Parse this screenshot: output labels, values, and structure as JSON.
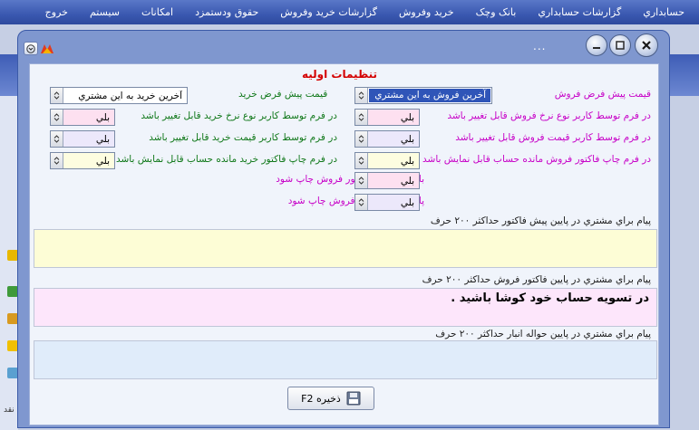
{
  "menu": {
    "items": [
      "حسابداري",
      "گزارشات حسابداري",
      "بانک وچک",
      "خريد وفروش",
      "گزارشات خريد وفروش",
      "حقوق ودستمزد",
      "امکانات",
      "سيستم",
      "خروج"
    ]
  },
  "desktop": {
    "side_text": "نقد"
  },
  "window": {
    "title_dots": "...",
    "heading": "تنظيمات اوليه"
  },
  "form": {
    "sales_default_label": "قيمت پيش فرض فروش",
    "sales_default_value": "آخرين فروش به اين مشتري",
    "purchase_default_label": "قيمت پيش فرض خريد",
    "purchase_default_value": "آخرين خريد به اين مشتري",
    "sales_rows": [
      {
        "label": "در فرم توسط کاربر نوع نرخ  فروش  قابل تغيير باشد",
        "value": "بلي"
      },
      {
        "label": "در فرم توسط کاربر قيمت فروش  قابل تغيير باشد",
        "value": "بلي"
      },
      {
        "label": "در فرم چاپ فاکتور فروش مانده حساب قابل نمايش باشد",
        "value": "بلي"
      },
      {
        "label": "بالاي سربرگ فاکتور فروش چاپ شود",
        "value": "بلي"
      },
      {
        "label": "پايين برگه  فاکتور فروش چاپ شود",
        "value": "بلي"
      }
    ],
    "purchase_rows": [
      {
        "label": "در فرم توسط کاربر نوع نرخ خريد  قابل تغيير باشد",
        "value": "بلي"
      },
      {
        "label": "در فرم توسط کاربر قيمت خريد  قابل تغيير باشد",
        "value": "بلي"
      },
      {
        "label": "در فرم چاپ فاکتور خريد مانده حساب قابل نمايش باشد",
        "value": "بلي"
      }
    ]
  },
  "messages": {
    "pre_invoice_label": "پيام براي مشتري در پايين پيش فاکتور   حداکثر ۲۰۰ حرف",
    "pre_invoice_text": "",
    "sales_invoice_label": "پيام   براي مشتري در پايين فاکتور فروش    حداکثر ۲۰۰ حرف",
    "sales_invoice_text": "در تسويه حساب خود کوشا باشيد .",
    "warehouse_label": "پيام   براي مشتري در پايين حواله انبار    حداکثر ۲۰۰ حرف",
    "warehouse_text": ""
  },
  "actions": {
    "save_label": "F2 ذخيره"
  },
  "colors": {
    "pre_invoice_bg": "#fdfdd6",
    "sales_invoice_bg": "#fde6fb",
    "warehouse_bg": "#e0ecfa",
    "pink_field": "#fde0f0",
    "lavender_field": "#ece8fb",
    "yellow_field": "#fdfde0"
  }
}
